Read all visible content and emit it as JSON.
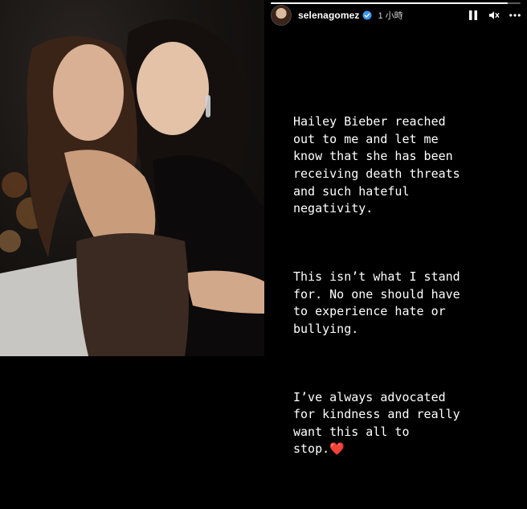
{
  "story": {
    "username": "selenagomez",
    "time_posted": "1 小時",
    "progress": 0.95,
    "icons": {
      "verified": "verified-badge-icon",
      "pause": "pause-icon",
      "mute": "muted-speaker-icon",
      "more": "more-options-icon"
    },
    "paragraphs": [
      "Hailey Bieber reached\nout to me and let me\nknow that she has been\nreceiving death threats\nand such hateful\nnegativity.",
      "This isn’t what I stand\nfor. No one should have\nto experience hate or\nbullying.",
      "I’ve always advocated\nfor kindness and really\nwant this all to\nstop."
    ],
    "heart_emoji": "❤️"
  },
  "colors": {
    "accent_heart": "#e0243a",
    "background": "#000000",
    "verified_blue": "#3897f0"
  }
}
